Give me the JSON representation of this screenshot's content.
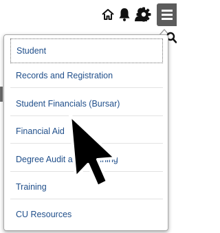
{
  "header": {
    "icons": [
      "home-icon",
      "bell-icon",
      "user-icon",
      "gear-icon",
      "hamburger-menu-icon",
      "search-icon"
    ]
  },
  "menu": {
    "items": [
      {
        "label": "Student",
        "focused": true
      },
      {
        "label": "Records and Registration"
      },
      {
        "label": "Student Financials (Bursar)"
      },
      {
        "label": "Financial Aid"
      },
      {
        "label": "Degree Audit and Planning"
      },
      {
        "label": "Training"
      },
      {
        "label": "CU Resources"
      }
    ]
  },
  "colors": {
    "link": "#1f4e8a",
    "menu_button": "#5c5c5c",
    "pointer": "#000000"
  }
}
